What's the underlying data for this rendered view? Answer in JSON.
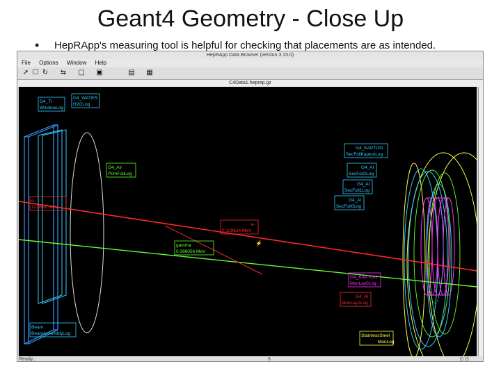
{
  "slide": {
    "title": "Geant4 Geometry - Close Up",
    "bullet": "•",
    "bullet_text": "HepRApp's measuring tool is helpful for checking that placements are as intended."
  },
  "window": {
    "title": "HepRApp Data Browser (version 3.15.0)",
    "menus": [
      "File",
      "Options",
      "Window",
      "Help"
    ],
    "doc_title": "C4Data1.heprep.gz",
    "tools": [
      "cursor-icon",
      "select-icon",
      "rotate-icon",
      "swap-icon",
      "square-icon",
      "square-icon",
      "folder-icon",
      "page-icon"
    ],
    "status_left": "Ready...",
    "status_mid": "8",
    "status_right": "⊡ ⊡"
  },
  "labels": {
    "ti": [
      "G4_Ti",
      "WindowLog"
    ],
    "water": [
      "G4_WATER",
      "H2OLog"
    ],
    "air_prim": [
      "G4_Air",
      "PrimFoilLog"
    ],
    "kapton_top": [
      "G4_KAPTON",
      "SecFoilKaptonLog"
    ],
    "al2": [
      "G4_Al",
      "SecFoil2Log"
    ],
    "al1": [
      "G4_Al",
      "SecFoil1Log"
    ],
    "al0": [
      "G4_Al",
      "SecFoil0Log"
    ],
    "e_left": [
      "e-",
      "11.0828 MeV"
    ],
    "e_mid": [
      "e-",
      "0.139624 MeV"
    ],
    "gamma": [
      "gamma",
      "0.396056 MeV"
    ],
    "kapton_mon": [
      "G4_KAPTON",
      "MonLay0Log"
    ],
    "al_mon": [
      "G4_Al",
      "MonLay1Log"
    ],
    "beam": [
      "Beam",
      "BeamAssemblyLog"
    ],
    "steel": [
      "StainlessSteel",
      "MonLog"
    ]
  },
  "colors": {
    "cyan": "#33ccff",
    "green": "#66ff33",
    "red": "#ff2a2a",
    "magenta": "#ff33ff",
    "yellow": "#ffff44"
  }
}
